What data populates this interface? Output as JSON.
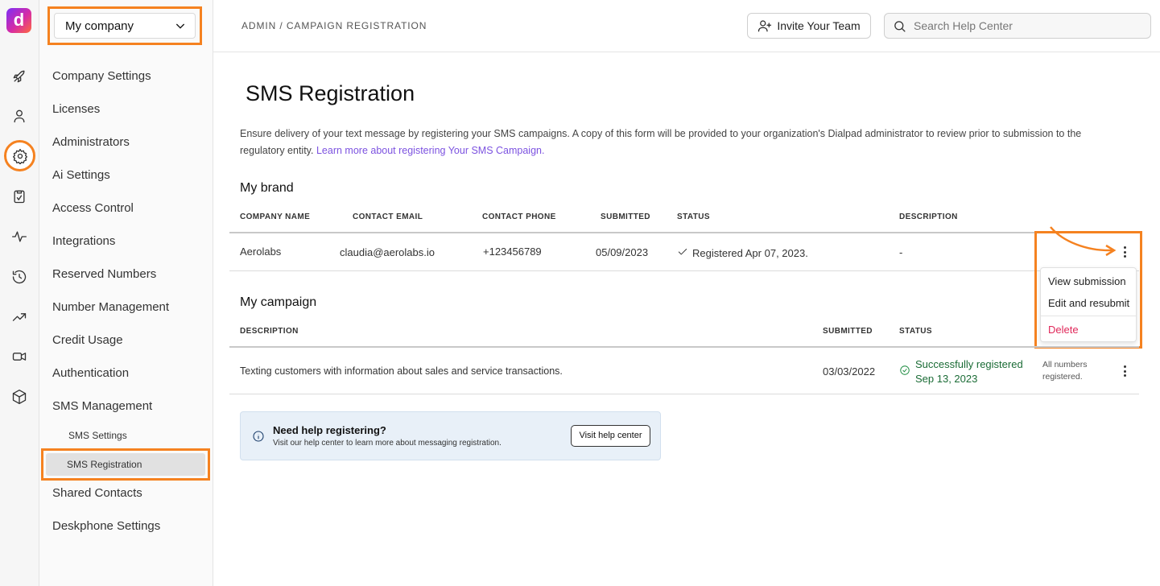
{
  "rail": {
    "icons": [
      "logo-icon",
      "rocket-icon",
      "user-icon",
      "gear-icon",
      "clipboard-icon",
      "activity-icon",
      "history-icon",
      "trending-icon",
      "video-icon",
      "cube-icon"
    ],
    "logo_letter": "d"
  },
  "nav": {
    "company": "My company",
    "items": [
      "Company Settings",
      "Licenses",
      "Administrators",
      "Ai Settings",
      "Access Control",
      "Integrations",
      "Reserved Numbers",
      "Number Management",
      "Credit Usage",
      "Authentication",
      "SMS Management"
    ],
    "sub_items": [
      "SMS Settings",
      "SMS Registration"
    ],
    "items_after": [
      "Shared Contacts",
      "Deskphone Settings"
    ]
  },
  "topbar": {
    "breadcrumb": "ADMIN / CAMPAIGN REGISTRATION",
    "invite_label": "Invite Your Team",
    "search_placeholder": "Search Help Center"
  },
  "page": {
    "title": "SMS Registration",
    "intro_text": "Ensure delivery of your text message by registering your SMS campaigns. A copy of this form will be provided to your organization's Dialpad administrator to review prior to submission to the regulatory entity.",
    "intro_link": "Learn more about registering Your SMS Campaign."
  },
  "brand": {
    "title": "My brand",
    "headers": [
      "COMPANY NAME",
      "CONTACT EMAIL",
      "CONTACT PHONE",
      "SUBMITTED",
      "STATUS",
      "DESCRIPTION"
    ],
    "row": {
      "company": "Aerolabs",
      "email": "claudia@aerolabs.io",
      "phone": "+123456789",
      "submitted": "05/09/2023",
      "status": "Registered Apr 07, 2023.",
      "description": "-"
    }
  },
  "menu": {
    "items": [
      "View submission",
      "Edit and resubmit",
      "Delete"
    ]
  },
  "campaign": {
    "title": "My campaign",
    "headers": [
      "DESCRIPTION",
      "SUBMITTED",
      "STATUS"
    ],
    "row": {
      "description": "Texting customers with information about sales and service transactions.",
      "submitted": "03/03/2022",
      "status_line1": "Successfully registered",
      "status_line2": "Sep 13, 2023",
      "note_line1": "All numbers",
      "note_line2": "registered."
    }
  },
  "help": {
    "title": "Need help registering?",
    "subtitle": "Visit our help center to learn more about messaging registration.",
    "button": "Visit help center"
  },
  "colors": {
    "highlight": "#f58220",
    "link": "#7c52e0",
    "danger": "#e0285a",
    "success": "#1a6b35"
  }
}
